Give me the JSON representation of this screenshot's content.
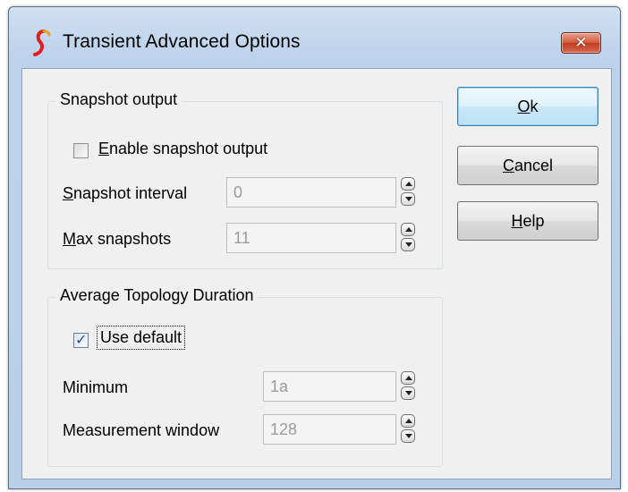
{
  "window": {
    "title": "Transient Advanced Options",
    "close_icon": "close-icon"
  },
  "snapshot_group": {
    "legend": "Snapshot output",
    "enable_checkbox": {
      "label_key": "E",
      "label_rest": "nable snapshot output",
      "checked": false
    },
    "interval": {
      "label_key": "S",
      "label_rest": "napshot interval",
      "value": "0"
    },
    "max": {
      "label_key": "M",
      "label_rest": "ax snapshots",
      "value": "11"
    }
  },
  "topology_group": {
    "legend": "Average Topology Duration",
    "use_default": {
      "label": "Use default",
      "checked": true
    },
    "minimum": {
      "label": "Minimum",
      "value": "1a"
    },
    "measurement": {
      "label": "Measurement window",
      "value": "128"
    }
  },
  "buttons": {
    "ok": {
      "key": "O",
      "rest": "k"
    },
    "cancel": {
      "key": "C",
      "rest": "ancel"
    },
    "help": {
      "key": "H",
      "rest": "elp"
    }
  },
  "colors": {
    "title_bg": "#c3d7ee",
    "close_red": "#c23c1f",
    "app_icon_red": "#e0201e",
    "app_icon_orange": "#f5a21b"
  }
}
